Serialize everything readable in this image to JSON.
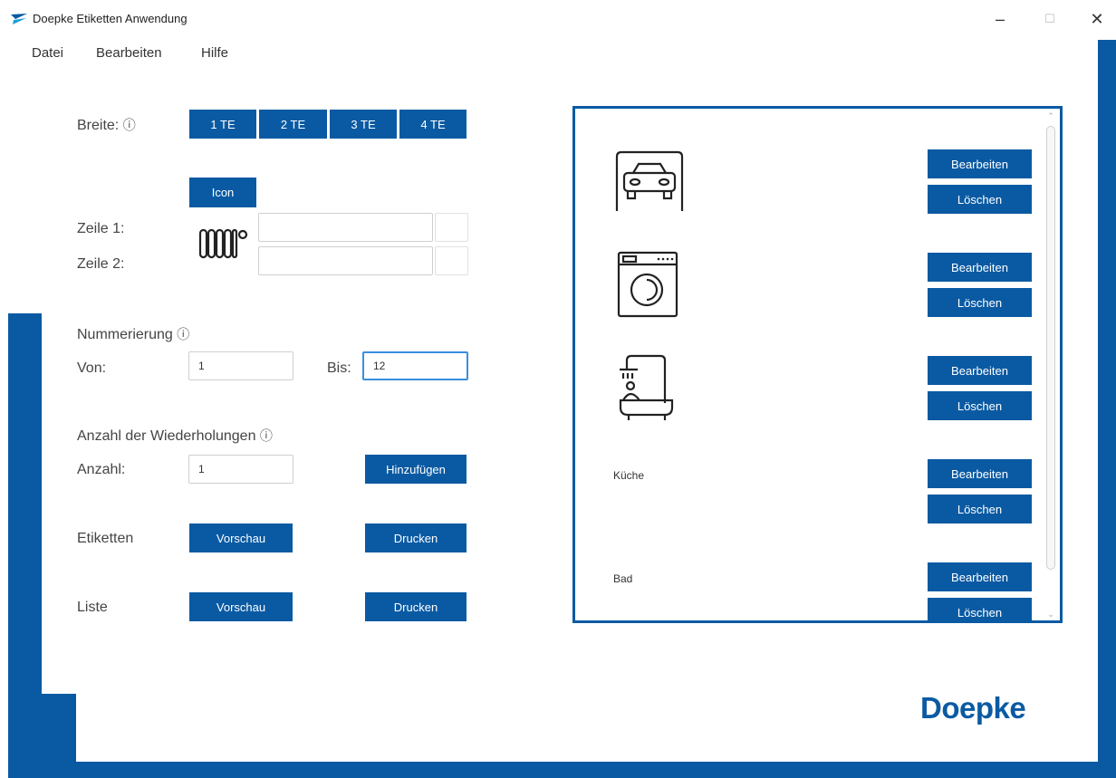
{
  "window": {
    "title": "Doepke Etiketten Anwendung",
    "minimize": "–",
    "maximize": "☐",
    "close": "✕"
  },
  "menu": [
    "Datei",
    "Bearbeiten",
    "Hilfe"
  ],
  "form": {
    "breite_label": "Breite:",
    "info_glyph": "ⓘ",
    "width_buttons": [
      "1 TE",
      "2 TE",
      "3 TE",
      "4 TE"
    ],
    "icon_button": "Icon",
    "zeile1_label": "Zeile 1:",
    "zeile2_label": "Zeile 2:",
    "zeile1_value": "",
    "zeile2_value": "",
    "nummerierung_label": "Nummerierung",
    "von_label": "Von:",
    "von_value": "1",
    "bis_label": "Bis:",
    "bis_value": "12",
    "wiederholungen_label": "Anzahl der Wiederholungen",
    "anzahl_label": "Anzahl:",
    "anzahl_value": "1",
    "hinzufuegen_button": "Hinzufügen",
    "etiketten_label": "Etiketten",
    "liste_label": "Liste",
    "vorschau_button": "Vorschau",
    "drucken_button": "Drucken"
  },
  "list": {
    "edit_label": "Bearbeiten",
    "delete_label": "Löschen",
    "items": [
      {
        "type": "icon",
        "icon": "car-garage-icon",
        "label": ""
      },
      {
        "type": "icon",
        "icon": "washing-machine-icon",
        "label": ""
      },
      {
        "type": "icon",
        "icon": "shower-bathtub-icon",
        "label": ""
      },
      {
        "type": "text",
        "icon": "",
        "label": "Küche"
      },
      {
        "type": "text",
        "icon": "",
        "label": "Bad"
      }
    ]
  },
  "brand": {
    "logo": "Doepke",
    "color": "#0a5aa3"
  }
}
